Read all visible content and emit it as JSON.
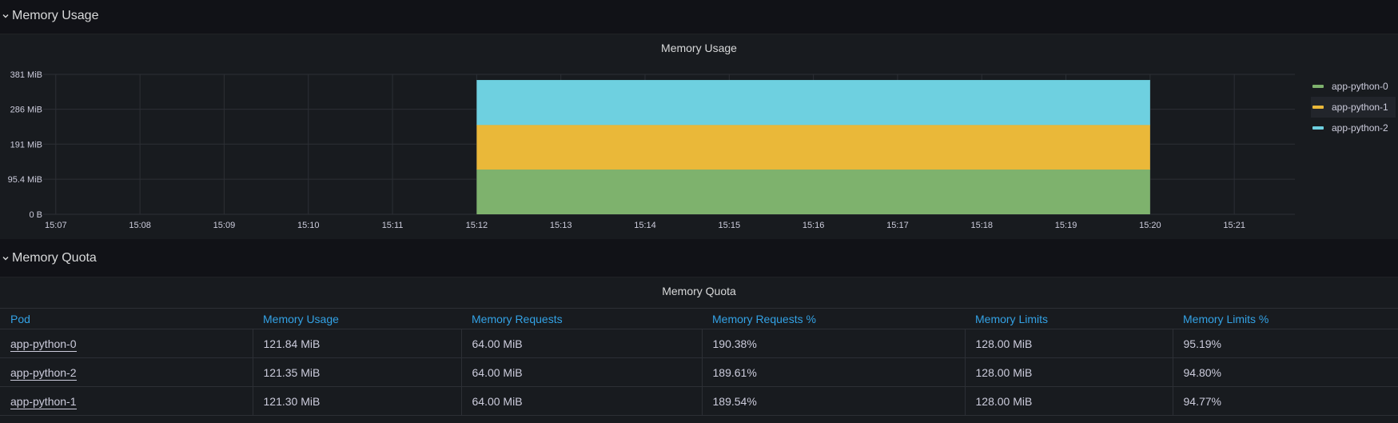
{
  "rows": {
    "memory_usage": {
      "title": "Memory Usage"
    },
    "memory_quota": {
      "title": "Memory Quota"
    }
  },
  "chart_panel": {
    "title": "Memory Usage"
  },
  "chart_data": {
    "type": "area",
    "stacked": true,
    "title": "Memory Usage",
    "y_tick_labels": [
      "0 B",
      "95.4 MiB",
      "191 MiB",
      "286 MiB",
      "381 MiB"
    ],
    "y_tick_values": [
      0,
      95.4,
      191,
      286,
      381
    ],
    "ylim": [
      0,
      381
    ],
    "y_unit": "MiB",
    "x_tick_labels": [
      "15:07",
      "15:08",
      "15:09",
      "15:10",
      "15:11",
      "15:12",
      "15:13",
      "15:14",
      "15:15",
      "15:16",
      "15:17",
      "15:18",
      "15:19",
      "15:20",
      "15:21"
    ],
    "x_start_minute": 0,
    "x_tick_minutes": [
      0,
      1,
      2,
      3,
      4,
      5,
      6,
      7,
      8,
      9,
      10,
      11,
      12,
      13,
      14
    ],
    "xlim_minutes": [
      -0.15,
      14.72
    ],
    "data_range": [
      "15:12",
      "15:20"
    ],
    "grid": true,
    "legend_position": "right",
    "series": [
      {
        "name": "app-python-0",
        "color": "#7eb26d",
        "value_mib": 121.84
      },
      {
        "name": "app-python-1",
        "color": "#eab839",
        "value_mib": 121.3
      },
      {
        "name": "app-python-2",
        "color": "#6ed0e0",
        "value_mib": 121.35
      }
    ]
  },
  "legend": {
    "items": [
      {
        "name": "app-python-0",
        "color": "#7eb26d"
      },
      {
        "name": "app-python-1",
        "color": "#eab839"
      },
      {
        "name": "app-python-2",
        "color": "#6ed0e0"
      }
    ]
  },
  "quota_panel": {
    "title": "Memory Quota",
    "columns": [
      "Pod",
      "Memory Usage",
      "Memory Requests",
      "Memory Requests %",
      "Memory Limits",
      "Memory Limits %"
    ],
    "rows": [
      [
        "app-python-0",
        "121.84 MiB",
        "64.00 MiB",
        "190.38%",
        "128.00 MiB",
        "95.19%"
      ],
      [
        "app-python-2",
        "121.35 MiB",
        "64.00 MiB",
        "189.61%",
        "128.00 MiB",
        "94.80%"
      ],
      [
        "app-python-1",
        "121.30 MiB",
        "64.00 MiB",
        "189.54%",
        "128.00 MiB",
        "94.77%"
      ]
    ]
  }
}
